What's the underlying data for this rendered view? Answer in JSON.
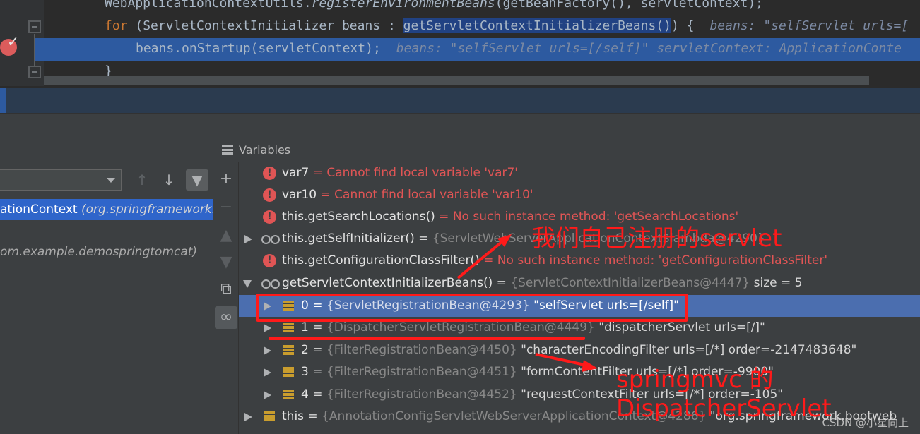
{
  "editor": {
    "line1": {
      "prefix": "WebApplicationContextUtils.",
      "method": "registerEnvironmentBeans",
      "args": "(getBeanFactory(), servletContext);"
    },
    "line2": {
      "kw": "for",
      "text": " (ServletContextInitializer beans : ",
      "selected": "getServletContextInitializerBeans()",
      "rest": ") {",
      "inline": "beans: \"selfServlet urls=["
    },
    "line3": {
      "text": "beans.onStartup(servletContext);",
      "inline": "beans: \"selfServlet urls=[/self]\"  servletContext: ApplicationConte"
    },
    "line4": {
      "text": "}"
    }
  },
  "frames": {
    "rows": [
      {
        "prefix": "ationContext ",
        "loc": "(org.springframework.b"
      },
      {
        "text": "om.example.demospringtomcat)"
      }
    ]
  },
  "variables": {
    "title": "Variables",
    "rows": [
      {
        "name": "var7",
        "value": "Cannot find local variable 'var7'"
      },
      {
        "name": "var10",
        "value": "Cannot find local variable 'var10'"
      },
      {
        "name": "this.getSearchLocations()",
        "value": "No such instance method: 'getSearchLocations'"
      },
      {
        "name": "this.getSelfInitializer()",
        "type": "{ServletWebServerApplicationContext$lambda@4290}"
      },
      {
        "name": "this.getConfigurationClassFilter()",
        "value": "No such instance method: 'getConfigurationClassFilter'"
      },
      {
        "name": "getServletContextInitializerBeans()",
        "type": "{ServletContextInitializerBeans@4447}",
        "extra": "size = 5"
      },
      {
        "index": "0",
        "type": "{ServletRegistrationBean@4293}",
        "value": "\"selfServlet urls=[/self]\""
      },
      {
        "index": "1",
        "type": "{DispatcherServletRegistrationBean@4449}",
        "value": "\"dispatcherServlet urls=[/]\""
      },
      {
        "index": "2",
        "type": "{FilterRegistrationBean@4450}",
        "value": "\"characterEncodingFilter urls=[/*] order=-2147483648\""
      },
      {
        "index": "3",
        "type": "{FilterRegistrationBean@4451}",
        "value": "\"formContentFilter urls=[/*] order=-9900\""
      },
      {
        "index": "4",
        "type": "{FilterRegistrationBean@4452}",
        "value": "\"requestContextFilter urls=[/*] order=-105\""
      },
      {
        "name": "this",
        "type": "{AnnotationConfigServletWebServerApplicationContext@4286}",
        "value": "\"org.springframework.bootweb"
      }
    ]
  },
  "annotations": {
    "label1": "我们自己注册的servlet",
    "label2_line1": "springmvc 的",
    "label2_line2": "DispatcherServlet"
  },
  "watermark": "CSDN @小星向上",
  "colors": {
    "annotation": "#ff1a1a",
    "selection": "#4b6eaf",
    "error": "#e05555"
  }
}
